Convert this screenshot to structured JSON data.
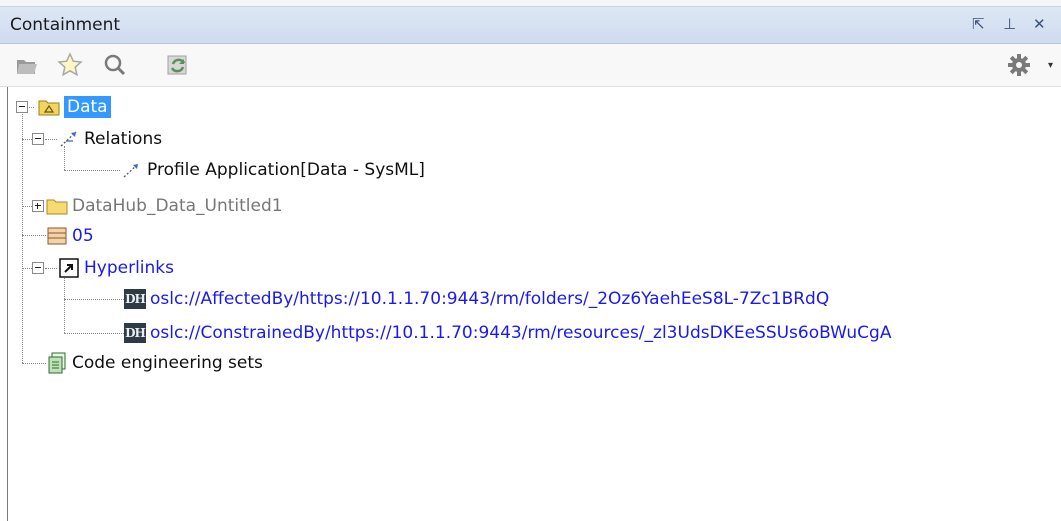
{
  "panel": {
    "title": "Containment",
    "buttons": {
      "float": "⇱",
      "pin": "⊥",
      "close": "✕"
    }
  },
  "toolbar": {
    "icons": [
      "open-folder-icon",
      "star-icon",
      "search-icon",
      "refresh-icon",
      "gear-icon"
    ]
  },
  "tree": {
    "root": {
      "label": "Data"
    },
    "relations": {
      "label": "Relations"
    },
    "profile_application": {
      "label": "Profile Application[Data - SysML]"
    },
    "datahub": {
      "label": "DataHub_Data_Untitled1"
    },
    "item05": {
      "label": "05"
    },
    "hyperlinks": {
      "label": "Hyperlinks"
    },
    "link1": {
      "icon_text": "DH",
      "label": "oslc://AffectedBy/https://10.1.1.70:9443/rm/folders/_2Oz6YaehEeS8L-7Zc1BRdQ"
    },
    "link2": {
      "icon_text": "DH",
      "label": "oslc://ConstrainedBy/https://10.1.1.70:9443/rm/resources/_zl3UdsDKEeSSUs6oBWuCgA"
    },
    "code_engineering": {
      "label": "Code engineering sets"
    }
  },
  "colors": {
    "selection": "#3399ff",
    "link": "#1a1af0",
    "muted": "#777777"
  }
}
